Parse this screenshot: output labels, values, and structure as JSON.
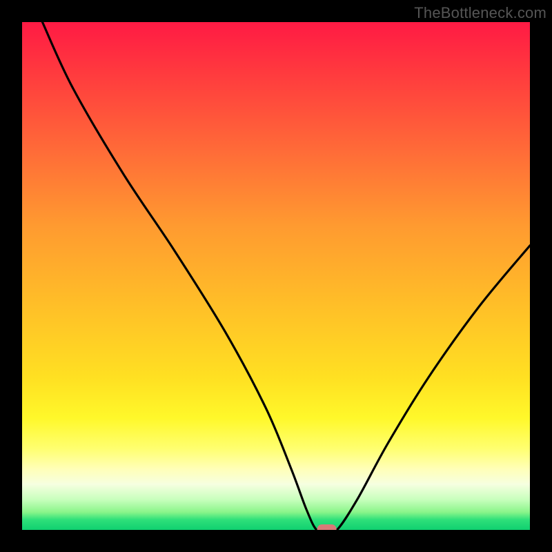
{
  "watermark": {
    "text": "TheBottleneck.com"
  },
  "chart_data": {
    "type": "line",
    "title": "",
    "xlabel": "",
    "ylabel": "",
    "xlim": [
      0,
      100
    ],
    "ylim": [
      0,
      100
    ],
    "grid": false,
    "legend": false,
    "background_gradient": {
      "orientation": "vertical",
      "stops": [
        {
          "pos": 0,
          "color": "#ff1a44"
        },
        {
          "pos": 25,
          "color": "#ff6a38"
        },
        {
          "pos": 55,
          "color": "#ffbd28"
        },
        {
          "pos": 78,
          "color": "#fff82a"
        },
        {
          "pos": 91,
          "color": "#f6ffe0"
        },
        {
          "pos": 100,
          "color": "#10d070"
        }
      ]
    },
    "series": [
      {
        "name": "bottleneck-curve",
        "x": [
          4,
          10,
          20,
          30,
          40,
          48,
          53,
          56,
          58,
          60,
          62,
          66,
          72,
          80,
          90,
          100
        ],
        "y": [
          100,
          87,
          70,
          55,
          39,
          24,
          12,
          4,
          0,
          0,
          0,
          6,
          17,
          30,
          44,
          56
        ]
      }
    ],
    "marker": {
      "name": "optimum-marker",
      "x": 60,
      "y": 0,
      "color": "#d87a78"
    }
  }
}
